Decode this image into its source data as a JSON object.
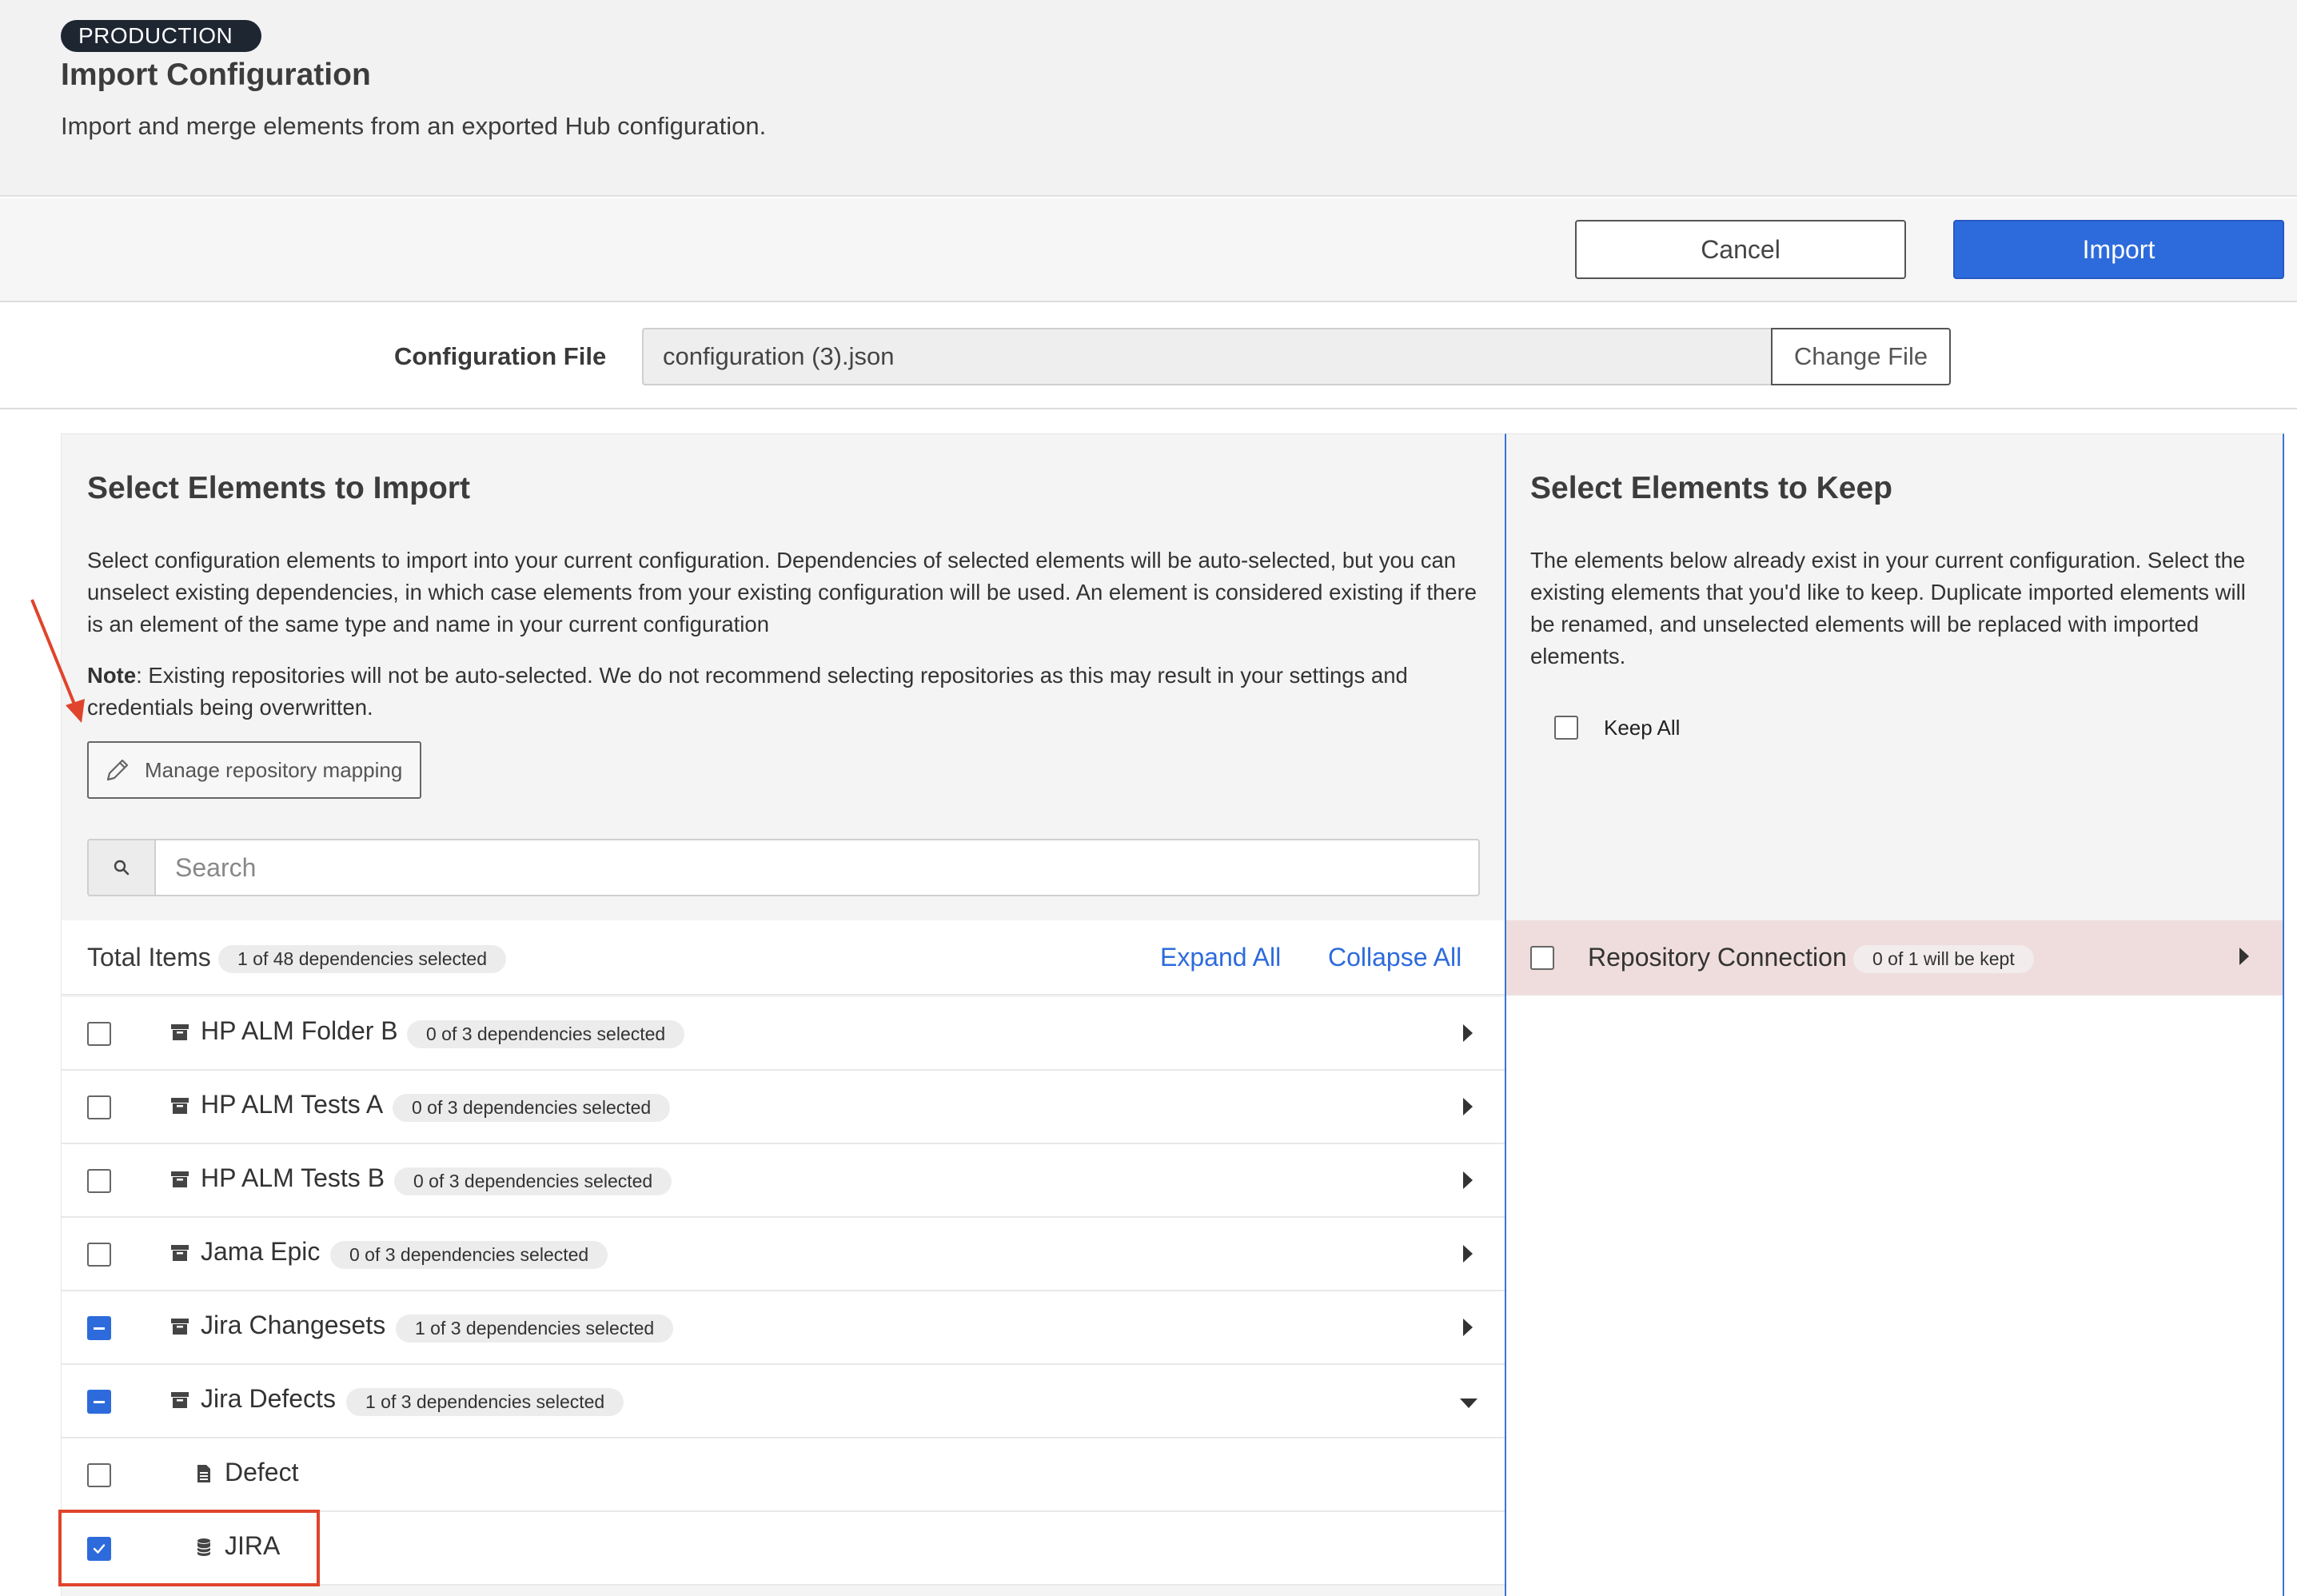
{
  "header": {
    "env_badge": "PRODUCTION",
    "title": "Import Configuration",
    "subtitle": "Import and merge elements from an exported Hub configuration."
  },
  "actions": {
    "cancel": "Cancel",
    "import": "Import"
  },
  "config_file": {
    "label": "Configuration File",
    "value": "configuration (3).json",
    "change_button": "Change File"
  },
  "import_panel": {
    "title": "Select Elements to Import",
    "description": "Select configuration elements to import into your current configuration. Dependencies of selected elements will be auto-selected, but you can unselect existing dependencies, in which case elements from your existing configuration will be used. An element is considered existing if there is an element of the same type and name in your current configuration",
    "note_label": "Note",
    "note_text": ": Existing repositories will not be auto-selected. We do not recommend selecting repositories as this may result in your settings and credentials being overwritten.",
    "manage_button": "Manage repository mapping",
    "search_placeholder": "Search",
    "total_label": "Total Items",
    "total_pill": "1 of 48 dependencies selected",
    "expand_all": "Expand All",
    "collapse_all": "Collapse All",
    "rows": [
      {
        "label": "HP ALM Folder B",
        "pill": "0 of 3 dependencies selected",
        "state": "unchecked",
        "expanded": false
      },
      {
        "label": "HP ALM Tests A",
        "pill": "0 of 3 dependencies selected",
        "state": "unchecked",
        "expanded": false
      },
      {
        "label": "HP ALM Tests B",
        "pill": "0 of 3 dependencies selected",
        "state": "unchecked",
        "expanded": false
      },
      {
        "label": "Jama Epic",
        "pill": "0 of 3 dependencies selected",
        "state": "unchecked",
        "expanded": false
      },
      {
        "label": "Jira Changesets",
        "pill": "1 of 3 dependencies selected",
        "state": "indeterminate",
        "expanded": false
      },
      {
        "label": "Jira Defects",
        "pill": "1 of 3 dependencies selected",
        "state": "indeterminate",
        "expanded": true
      }
    ],
    "children": [
      {
        "label": "Defect",
        "state": "unchecked",
        "icon": "document-icon"
      },
      {
        "label": "JIRA",
        "state": "checked",
        "icon": "database-icon"
      }
    ]
  },
  "keep_panel": {
    "title": "Select Elements to Keep",
    "description": "The elements below already exist in your current configuration. Select the existing elements that you'd like to keep. Duplicate imported elements will be renamed, and unselected elements will be replaced with imported elements.",
    "keep_all": "Keep All",
    "group_label": "Repository Connection",
    "group_pill": "0 of 1 will be kept"
  },
  "colors": {
    "accent": "#2d6bdc",
    "badge_bg": "#1e2632",
    "annotation": "#e0442c",
    "keep_row_bg": "#efdddd"
  }
}
